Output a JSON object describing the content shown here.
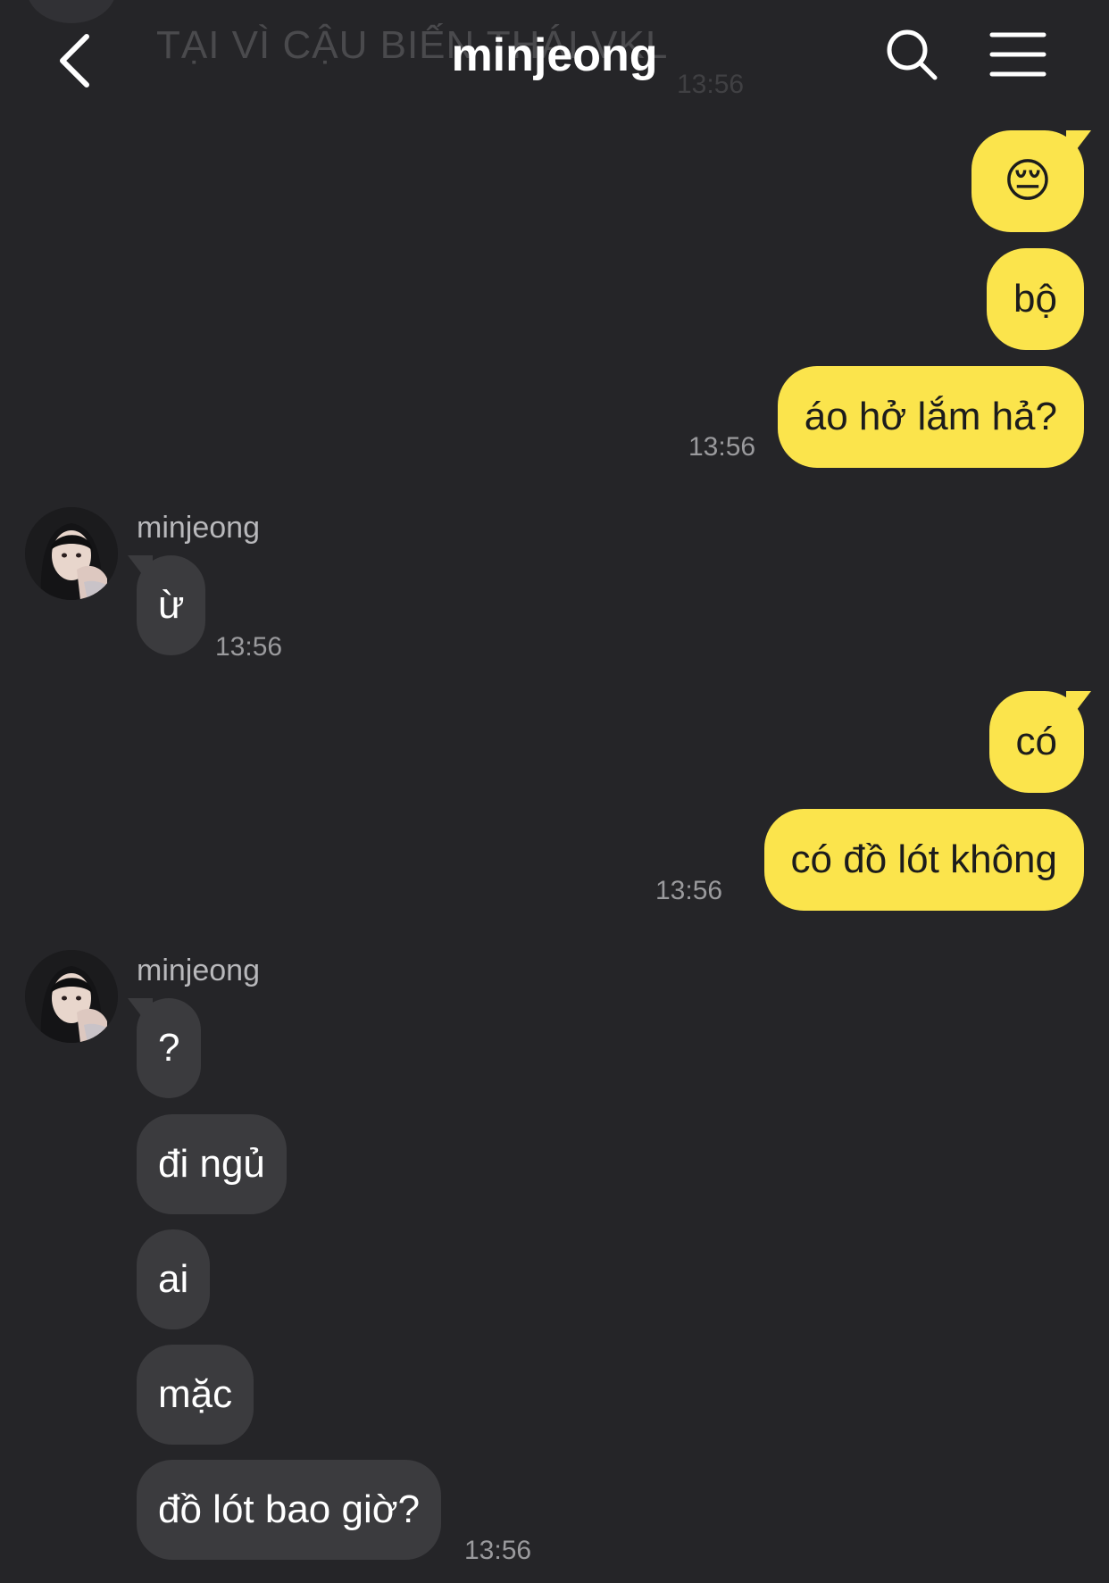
{
  "header": {
    "title": "minjeong",
    "behind_text": "TẠI VÌ CẬU BIẾN THÁI VKL",
    "behind_time": "13:56"
  },
  "messages": {
    "sent1": "😔",
    "sent2": "bộ",
    "sent3": "áo hở lắm hả?",
    "sent3_time": "13:56",
    "recv_sender1": "minjeong",
    "recv1": "ừ",
    "recv1_time": "13:56",
    "sent4": "có",
    "sent5": "có đồ lót không",
    "sent5_time": "13:56",
    "recv_sender2": "minjeong",
    "recv2": "?",
    "recv3": "đi ngủ",
    "recv4": "ai",
    "recv5": "mặc",
    "recv6": "đồ lót bao giờ?",
    "recv6_time": "13:56"
  },
  "colors": {
    "background": "#252528",
    "sent_bubble": "#fbe44c",
    "received_bubble": "#3b3b3e"
  }
}
